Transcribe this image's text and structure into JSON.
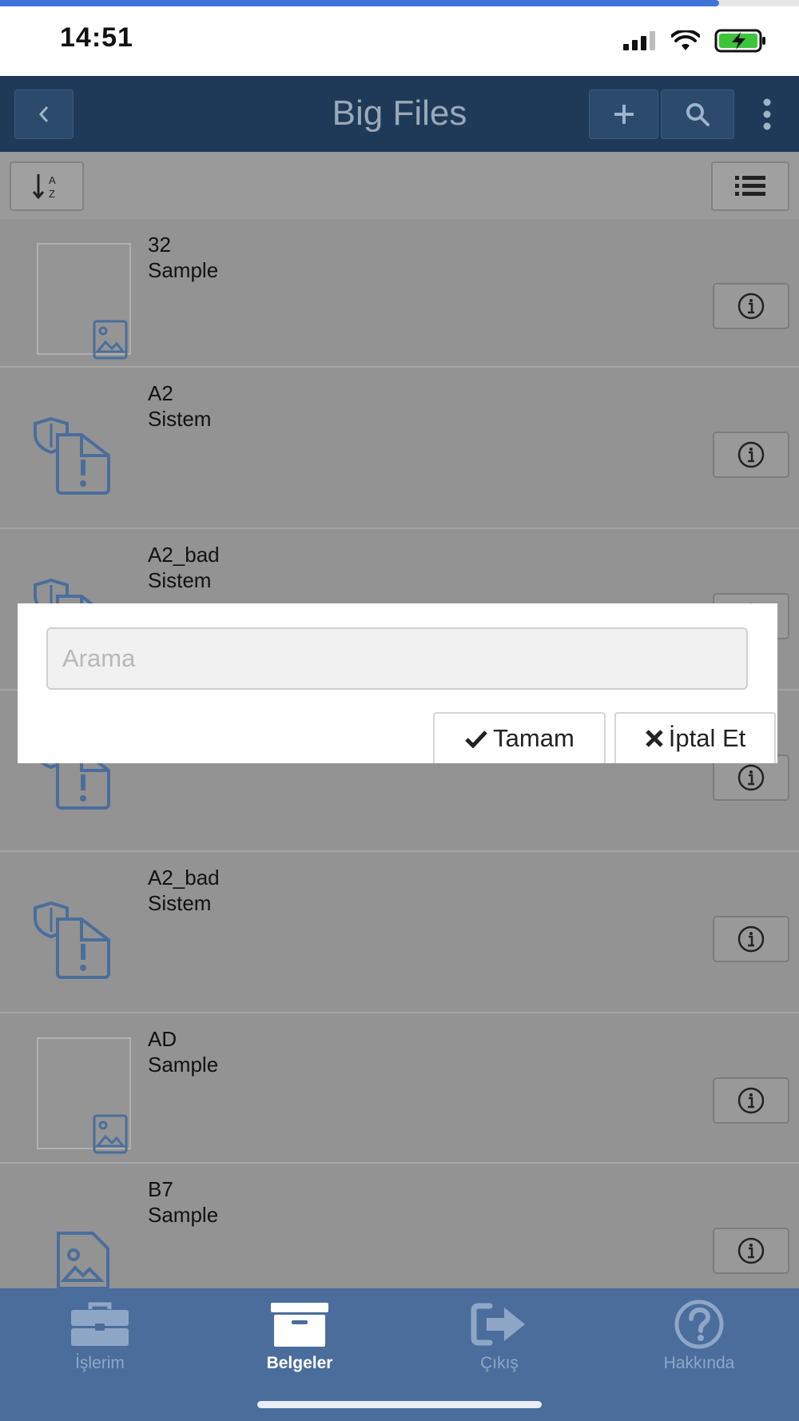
{
  "progress": {
    "fraction": 0.9
  },
  "status": {
    "time": "14:51"
  },
  "nav": {
    "title": "Big Files"
  },
  "list": {
    "items": [
      {
        "title": "32",
        "subtitle": "Sample",
        "icon": "image-file-icon"
      },
      {
        "title": "A2",
        "subtitle": "Sistem",
        "icon": "shield-file-warning-icon"
      },
      {
        "title": "A2_bad",
        "subtitle": "Sistem",
        "icon": "shield-file-warning-icon"
      },
      {
        "title": "",
        "subtitle": "",
        "icon": "shield-file-warning-icon"
      },
      {
        "title": "A2_bad",
        "subtitle": "Sistem",
        "icon": "shield-file-warning-icon"
      },
      {
        "title": "AD",
        "subtitle": "Sample",
        "icon": "image-file-icon"
      },
      {
        "title": "B7",
        "subtitle": "Sample",
        "icon": "image-file-icon"
      }
    ]
  },
  "dialog": {
    "placeholder": "Arama",
    "ok_label": "Tamam",
    "cancel_label": "İptal Et"
  },
  "tabs": [
    {
      "label": "İşlerim",
      "icon": "briefcase-icon",
      "active": false
    },
    {
      "label": "Belgeler",
      "icon": "archive-box-icon",
      "active": true
    },
    {
      "label": "Çıkış",
      "icon": "sign-out-icon",
      "active": false
    },
    {
      "label": "Hakkında",
      "icon": "question-circle-icon",
      "active": false
    }
  ],
  "colors": {
    "nav_bg": "#1f3a58",
    "tabbar_bg": "#4b6d9c",
    "progress": "#3f73d9",
    "file_icon": "#4a6e9c"
  }
}
